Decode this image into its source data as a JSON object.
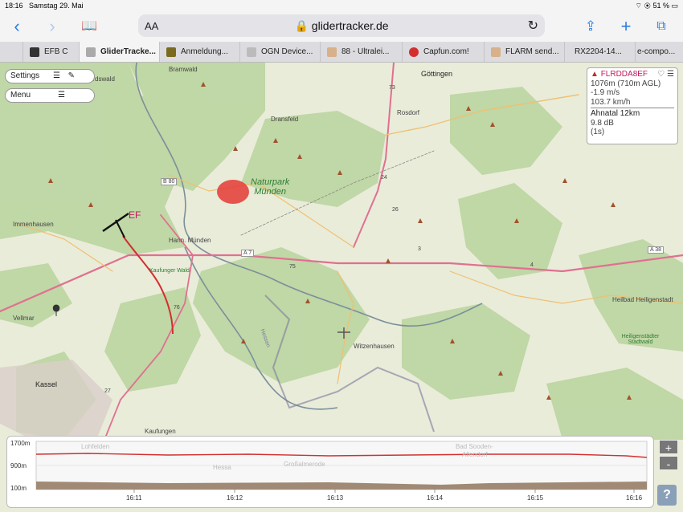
{
  "status": {
    "time": "18:16",
    "date": "Samstag 29. Mai",
    "battery": "51 %"
  },
  "toolbar": {
    "back_icon": "chevron-left-icon",
    "forward_icon": "chevron-right-icon",
    "bookmarks_icon": "book-icon",
    "text_size": "AA",
    "url": "glidertracker.de",
    "share_icon": "share-icon",
    "add_icon": "plus-icon",
    "tabs_icon": "tabs-icon"
  },
  "tabs": [
    {
      "label": "EFB C"
    },
    {
      "label": "GliderTracke..."
    },
    {
      "label": "Anmeldung..."
    },
    {
      "label": "OGN Device..."
    },
    {
      "label": "88 - Ultralei..."
    },
    {
      "label": "Capfun.com!"
    },
    {
      "label": "FLARM send..."
    },
    {
      "label": "RX2204-14..."
    },
    {
      "label": "e-compo..."
    }
  ],
  "controls": {
    "settings": "Settings",
    "menu": "Menu"
  },
  "map": {
    "labels": {
      "bramwald": "Bramwald",
      "goettingen": "Göttingen",
      "dransfeld": "Dransfeld",
      "rosdorf": "Rosdorf",
      "park1": "Naturpark",
      "park2": "Münden",
      "immenhausen": "Immenhausen",
      "hann_muenden": "Hann. Münden",
      "vellmar": "Vellmar",
      "kassel": "Kassel",
      "witzenhausen": "Witzenhausen",
      "heilbad": "Heilbad Heiligenstadt",
      "stadtwald": "Heiligenstädter Stadtwald",
      "kaufungen": "Kaufungen",
      "rad_wald": "Reinhardswald",
      "b80": "B 80",
      "a7": "A 7",
      "a38": "A 38",
      "r73": "73",
      "r75": "75",
      "r76": "76",
      "r27": "27",
      "r24": "24",
      "r26": "26",
      "r3": "3",
      "r4": "4",
      "kaufunger_wald": "Kaufunger Wald",
      "hessen": "Hessen"
    },
    "glider_label": "EF"
  },
  "info": {
    "callsign": "FLRDDA8EF",
    "altitude": "1076m (710m AGL)",
    "vario": "-1.9 m/s",
    "speed": "103.7 km/h",
    "receiver": "Ahnatal 12km",
    "signal": "9.8 dB",
    "age": "(1s)"
  },
  "barogram": {
    "y_labels": [
      "1700m",
      "900m",
      "100m"
    ],
    "x_labels": [
      "16:11",
      "16:12",
      "16:13",
      "16:14",
      "16:15",
      "16:16"
    ],
    "bg_labels": [
      "Lohfelden",
      "Hessa",
      "Großalmerode",
      "Bad Sooden-",
      "Allendorf"
    ]
  },
  "zoom": {
    "in": "+",
    "out": "-"
  },
  "help": "?",
  "colors": {
    "accent": "#2a7ae4",
    "track": "#d32f2f",
    "callsign": "#c2185b"
  }
}
